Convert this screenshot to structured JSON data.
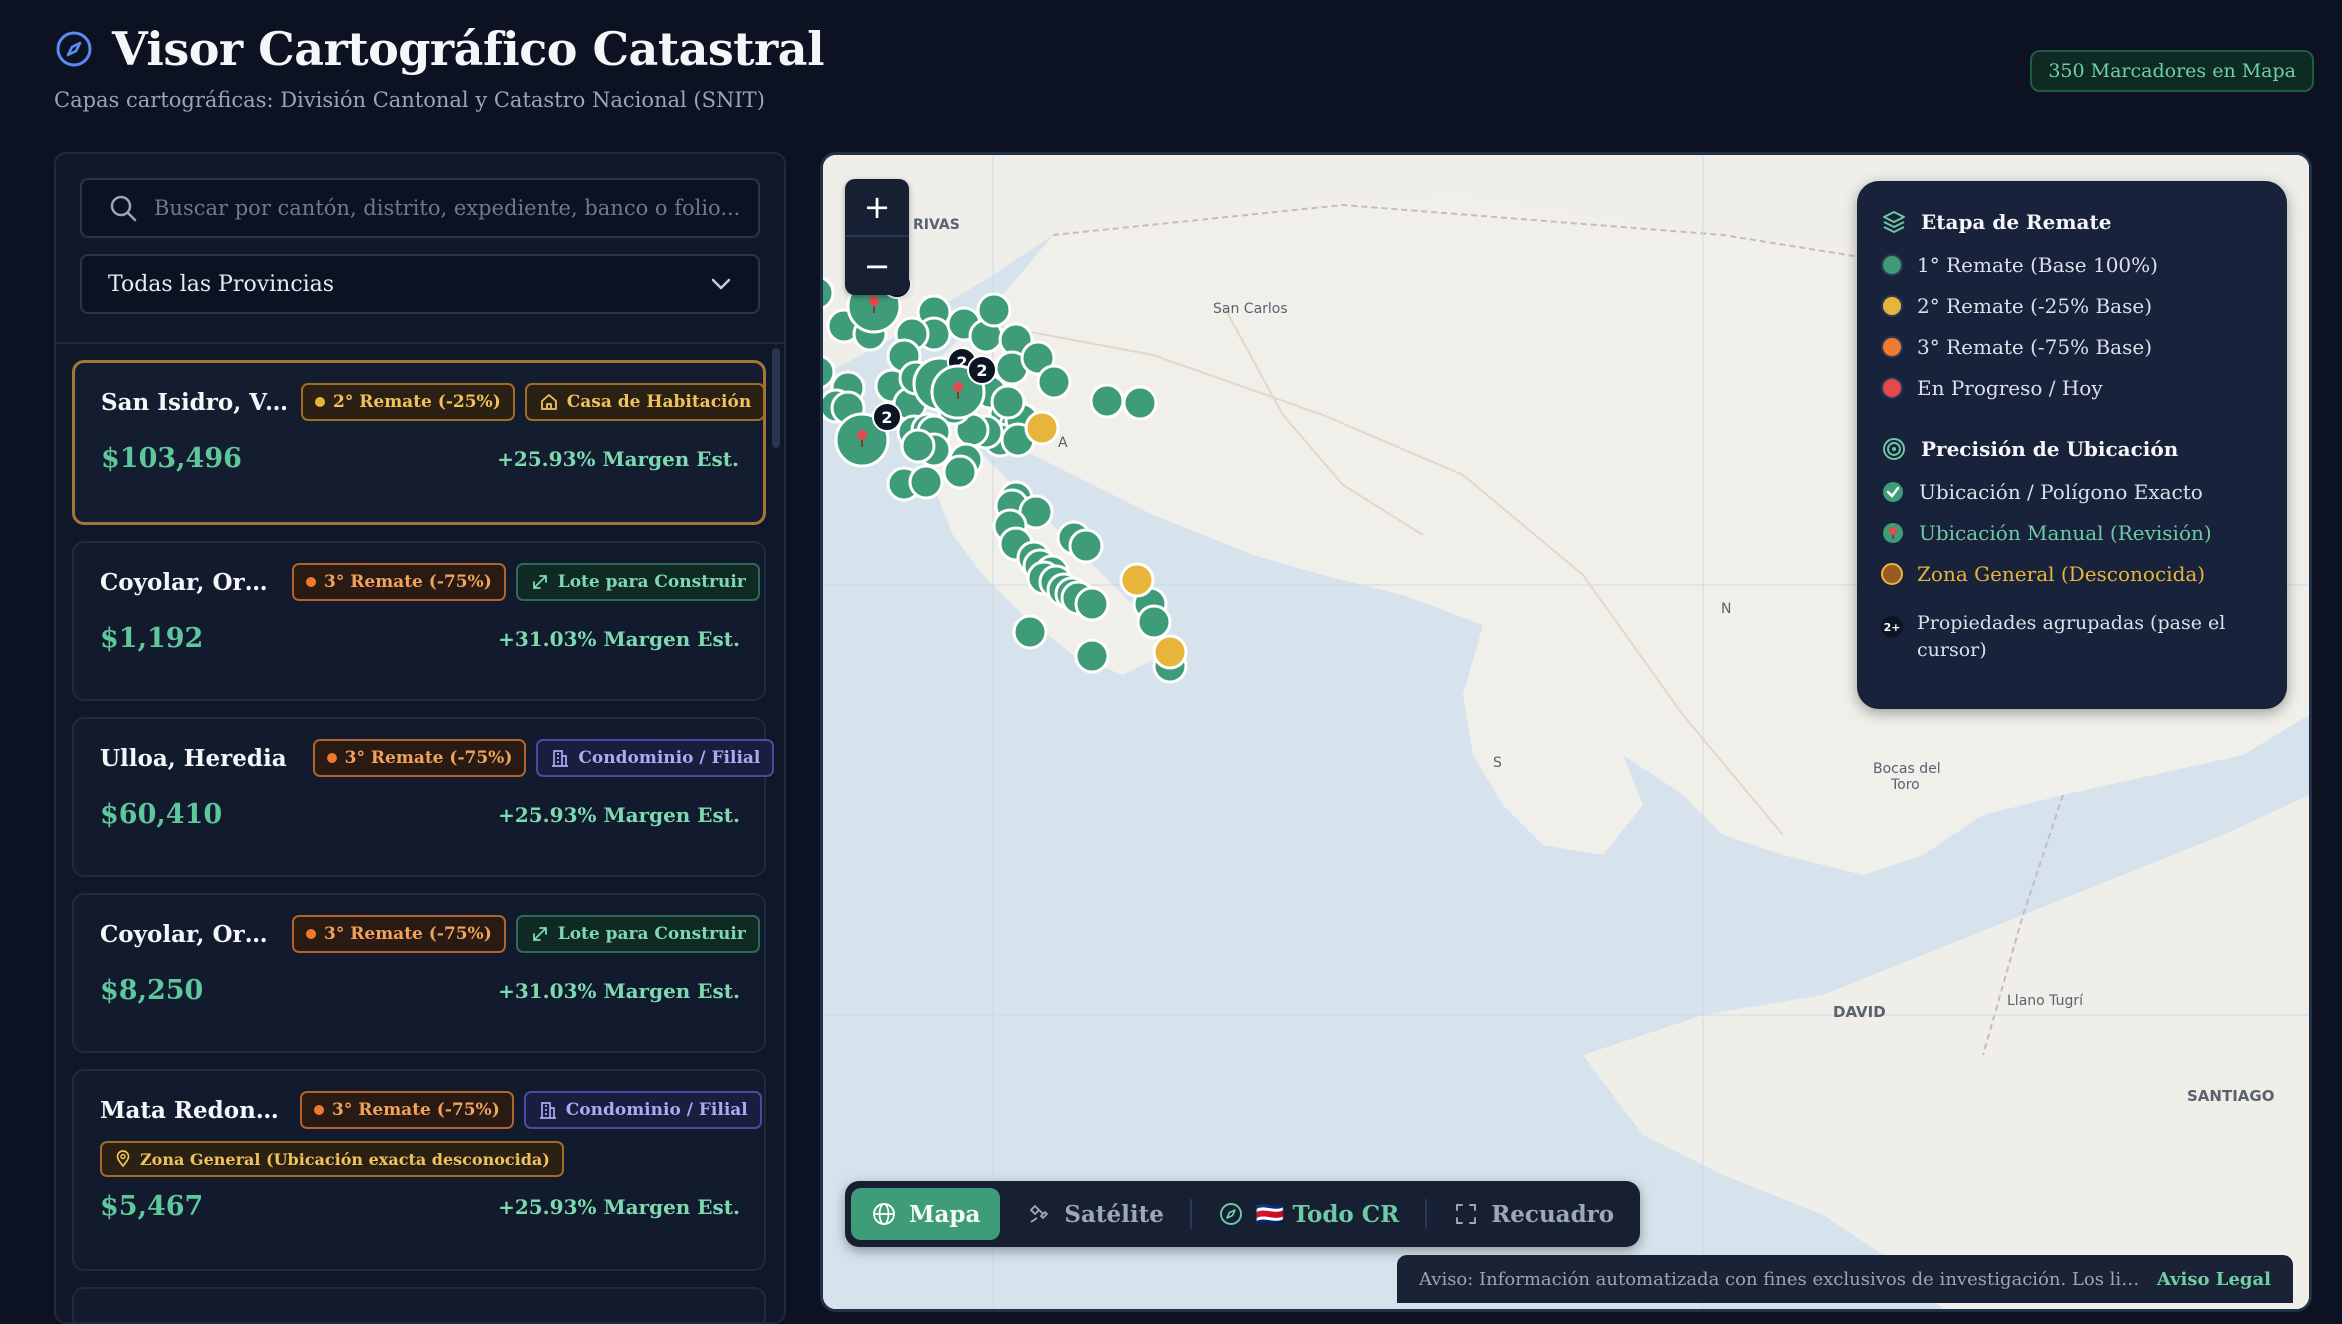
{
  "header": {
    "title": "Visor Cartográfico Catastral",
    "subtitle": "Capas cartográficas: División Cantonal y Catastro Nacional (SNIT)",
    "marker_count": "350 Marcadores en Mapa"
  },
  "sidebar": {
    "search_placeholder": "Buscar por cantón, distrito, expediente, banco o folio...",
    "province_select": "Todas las Provincias",
    "cards": [
      {
        "title": "San Isidro, Vá...",
        "stage": "2° Remate (-25%)",
        "stage_color": "amber",
        "type": "Casa de Habitación",
        "type_icon": "home-icon",
        "type_color": "amber",
        "price": "$103,496",
        "margin": "+25.93% Margen Est.",
        "active": true
      },
      {
        "title": "Coyolar, Orot...",
        "stage": "3° Remate (-75%)",
        "stage_color": "orange",
        "type": "Lote para Construir",
        "type_icon": "expand-icon",
        "type_color": "green",
        "price": "$1,192",
        "margin": "+31.03% Margen Est."
      },
      {
        "title": "Ulloa, Heredia",
        "stage": "3° Remate (-75%)",
        "stage_color": "orange",
        "type": "Condominio / Filial",
        "type_icon": "building-icon",
        "type_color": "violet",
        "price": "$60,410",
        "margin": "+25.93% Margen Est."
      },
      {
        "title": "Coyolar, Orot...",
        "stage": "3° Remate (-75%)",
        "stage_color": "orange",
        "type": "Lote para Construir",
        "type_icon": "expand-icon",
        "type_color": "green",
        "price": "$8,250",
        "margin": "+31.03% Margen Est."
      },
      {
        "title": "Mata Redond...",
        "stage": "3° Remate (-75%)",
        "stage_color": "orange",
        "type": "Condominio / Filial",
        "type_icon": "building-icon",
        "type_color": "violet",
        "zone": "Zona General (Ubicación exacta desconocida)",
        "price": "$5,467",
        "margin": "+25.93% Margen Est."
      }
    ]
  },
  "map": {
    "zoom_in": "+",
    "zoom_out": "−",
    "labels": {
      "rivas": "RIVAS",
      "san_carlos": "San Carlos",
      "bocas": "Bocas del",
      "toro": "Toro",
      "david": "DAVID",
      "llano": "Llano Tugrí",
      "santiago": "SANTIAGO",
      "partial_a": "A",
      "partial_s": "S",
      "partial_n": "N"
    },
    "cluster_count": "2",
    "colors": {
      "green": "#3e9c78",
      "amber": "#e8b53a",
      "orange": "#f07a2e",
      "red": "#e5484d",
      "water": "#d5e3ec",
      "land": "#efeee9"
    }
  },
  "legend": {
    "stage_title": "Etapa de Remate",
    "stages": [
      {
        "label": "1° Remate (Base 100%)",
        "color": "#3e9c78"
      },
      {
        "label": "2° Remate (-25% Base)",
        "color": "#e8b53a"
      },
      {
        "label": "3° Remate (-75% Base)",
        "color": "#f07a2e"
      },
      {
        "label": "En Progreso / Hoy",
        "color": "#e5484d"
      }
    ],
    "precision_title": "Precisión de Ubicación",
    "precision": [
      {
        "label": "Ubicación / Polígono Exacto",
        "color": "#dbe1ea"
      },
      {
        "label": "Ubicación Manual (Revisión)",
        "color": "#6fcaa3"
      },
      {
        "label": "Zona General (Desconocida)",
        "color": "#e8b53a"
      }
    ],
    "cluster_icon": "2+",
    "cluster_label": "Propiedades agrupadas (pase el cursor)"
  },
  "toolbar": {
    "map": "Mapa",
    "satellite": "Satélite",
    "all_cr": "🇨🇷 Todo CR",
    "crop": "Recuadro"
  },
  "disclaimer": {
    "text": "Aviso: Información automatizada con fines exclusivos de investigación. Los linderos y d...",
    "legal": "Aviso Legal"
  }
}
